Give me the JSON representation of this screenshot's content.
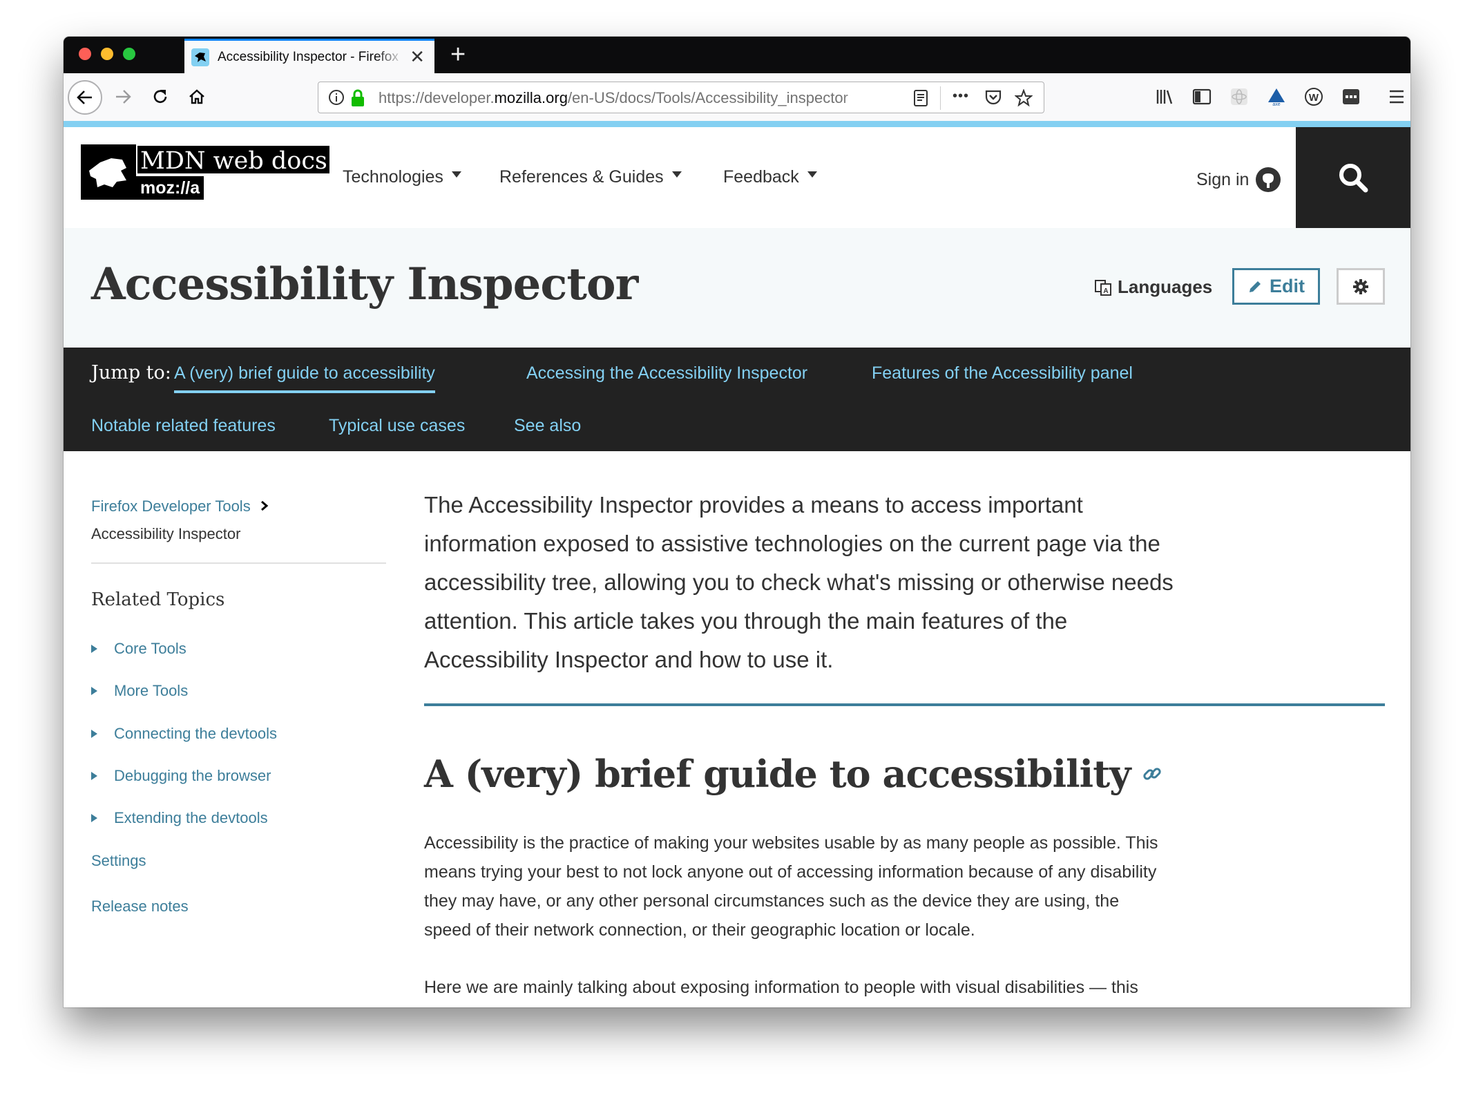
{
  "browser": {
    "tab_title": "Accessibility Inspector - Firefox",
    "url_prefix": "https://developer.",
    "url_host": "mozilla.org",
    "url_path": "/en-US/docs/Tools/Accessibility_inspector",
    "new_tab_symbol": "+",
    "close_symbol": "✕",
    "overflow_symbol": "•••"
  },
  "header": {
    "logo_text": "MDN web docs",
    "logo_moz": "moz://a",
    "nav": [
      {
        "label": "Technologies"
      },
      {
        "label": "References & Guides"
      },
      {
        "label": "Feedback"
      }
    ],
    "signin_label": "Sign in"
  },
  "title_band": {
    "title": "Accessibility Inspector",
    "languages_label": "Languages",
    "edit_label": "Edit"
  },
  "jump": {
    "label": "Jump to:",
    "links": [
      "A (very) brief guide to accessibility",
      "Accessing the Accessibility Inspector",
      "Features of the Accessibility panel",
      "Notable related features",
      "Typical use cases",
      "See also"
    ]
  },
  "sidebar": {
    "breadcrumb_parent": "Firefox Developer Tools",
    "breadcrumb_current": "Accessibility Inspector",
    "related_title": "Related Topics",
    "items": [
      {
        "label": "Core Tools"
      },
      {
        "label": "More Tools"
      },
      {
        "label": "Connecting the devtools"
      },
      {
        "label": "Debugging the browser"
      },
      {
        "label": "Extending the devtools"
      },
      {
        "label": "Settings"
      },
      {
        "label": "Release notes"
      }
    ]
  },
  "content": {
    "intro": "The Accessibility Inspector provides a means to access important information exposed to assistive technologies on the current page via the accessibility tree, allowing you to check what's missing or otherwise needs attention. This article takes you through the main features of the Accessibility Inspector and how to use it.",
    "section_title": "A (very) brief guide to accessibility",
    "para1": "Accessibility is the practice of making your websites usable by as many people as possible. This means trying your best to not lock anyone out of accessing information because of any disability they may have, or any other personal circumstances such as the device they are using, the speed of their network connection, or their geographic location or locale.",
    "para2": "Here we are mainly talking about exposing information to people with visual disabilities — this"
  },
  "colors": {
    "link": "#3d7e9a",
    "jump_link": "#83d0f2",
    "dark_band": "#222222",
    "title_band": "#f5f9fa"
  }
}
